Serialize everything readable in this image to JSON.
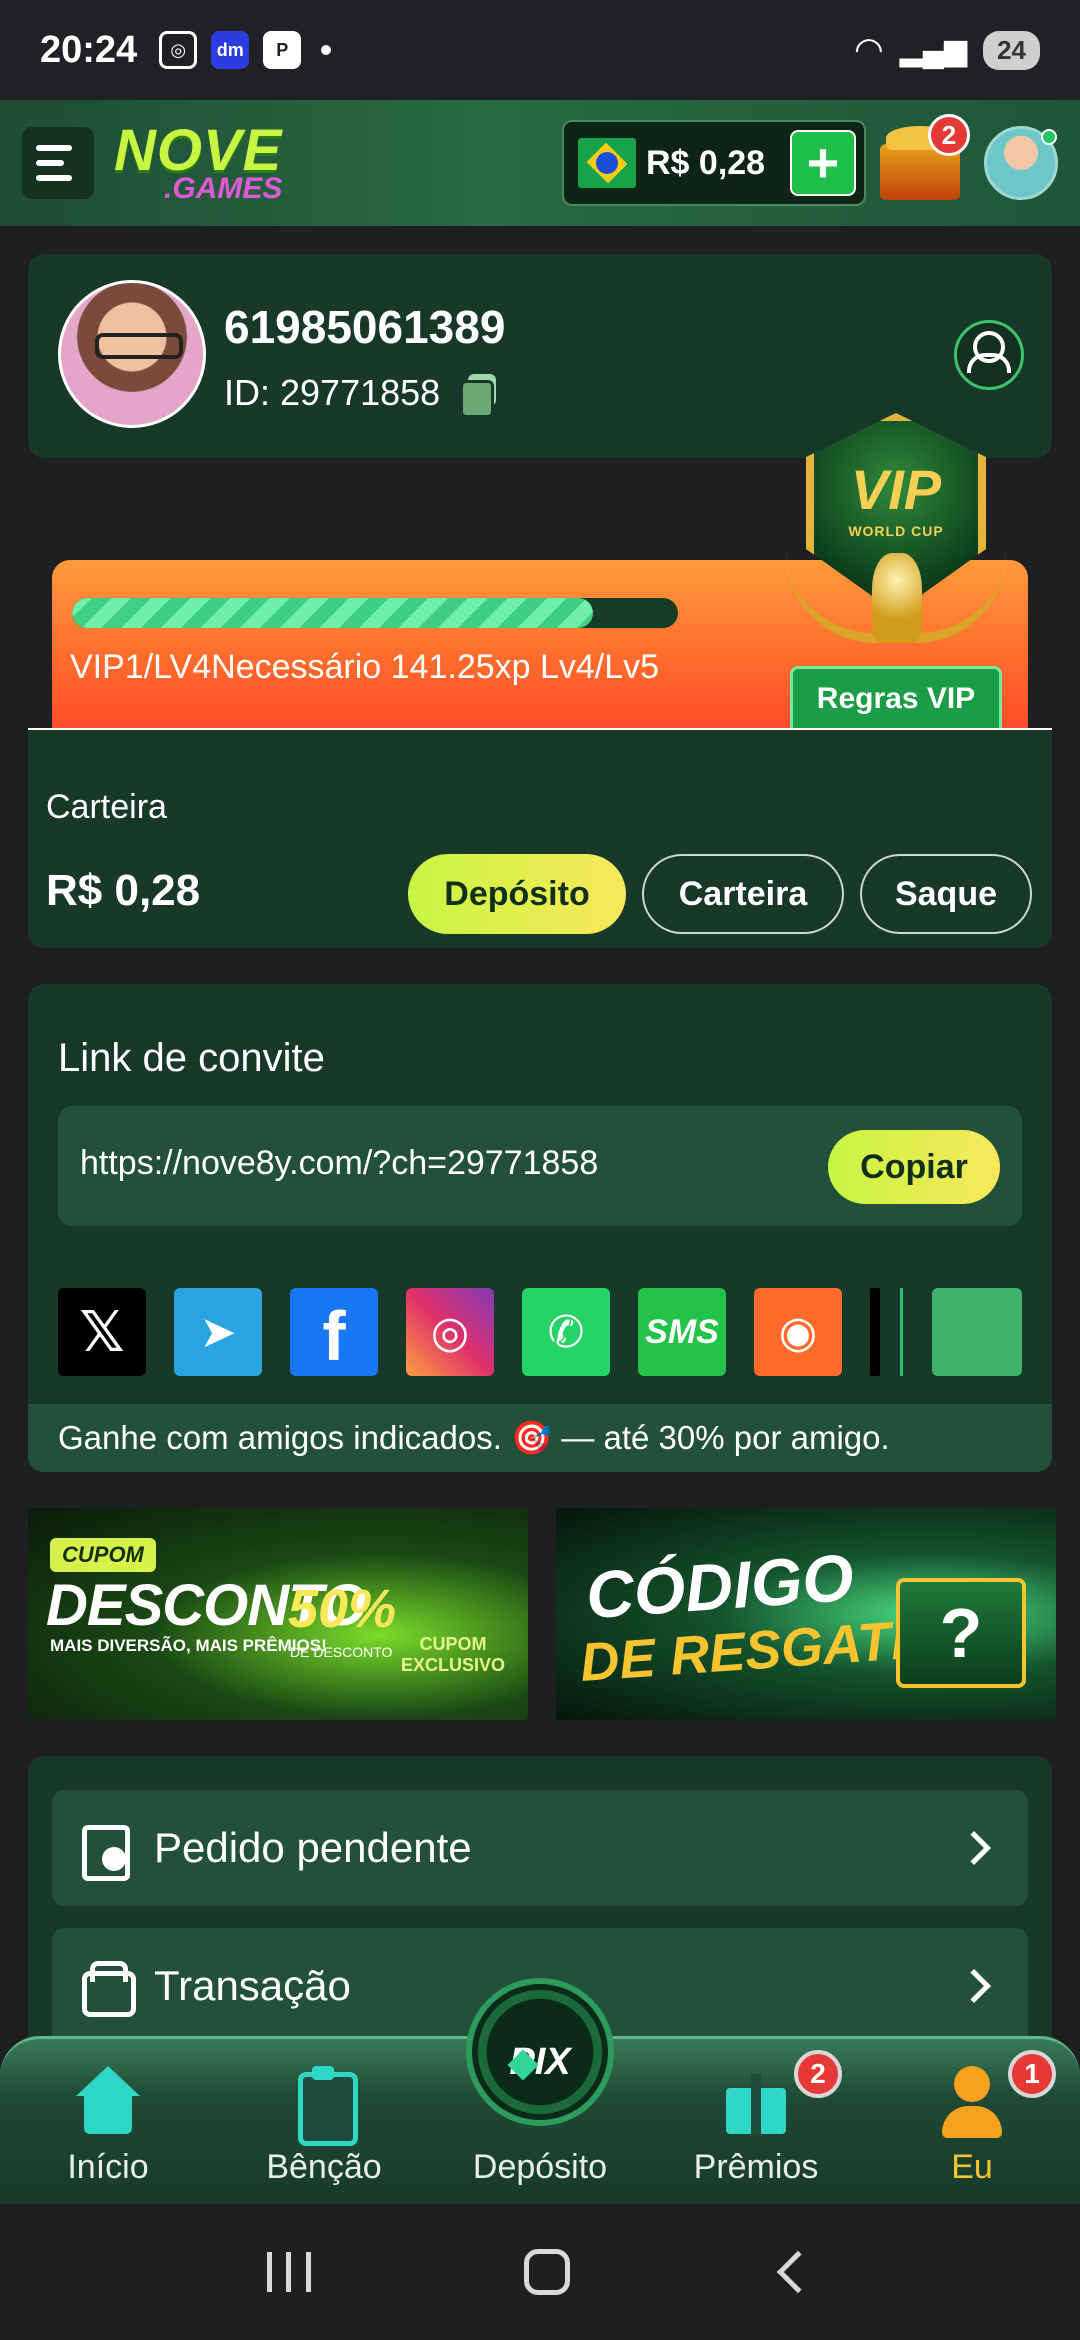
{
  "status_bar": {
    "time": "20:24",
    "app_icons": [
      "instagram-icon",
      "dm-icon",
      "pix-icon"
    ],
    "battery": "24"
  },
  "header": {
    "logo_top": "NOVE",
    "logo_bottom": ".GAMES",
    "balance": "R$ 0,28",
    "plus": "+",
    "gift_badge": "2"
  },
  "profile": {
    "phone": "61985061389",
    "id": "ID: 29771858"
  },
  "vip": {
    "badge_title": "VIP",
    "badge_sub": "WORLD CUP",
    "progress": 0.86,
    "text": "VIP1/LV4Necessário 141.25xp Lv4/Lv5",
    "rules_button": "Regras VIP"
  },
  "wallet": {
    "label": "Carteira",
    "amount": "R$ 0,28",
    "buttons": {
      "deposit": "Depósito",
      "wallet": "Carteira",
      "withdraw": "Saque"
    }
  },
  "invite": {
    "title": "Link de convite",
    "url": "https://nove8y.com/?ch=29771858",
    "copy_button": "Copiar",
    "socials": [
      "x-icon",
      "telegram-icon",
      "facebook-icon",
      "instagram-icon",
      "whatsapp-icon",
      "sms-icon",
      "kwai-icon",
      "more-apps-icon"
    ],
    "footer": "Ganhe com amigos indicados. 🎯 — até 30% por amigo."
  },
  "banners": {
    "discount": {
      "tag": "CUPOM",
      "title": "DESCONTO",
      "subtitle": "MAIS DIVERSÃO, MAIS PRÊMIOS!",
      "percent": "50%",
      "percent_sub": "DE DESCONTO",
      "coupon": "CUPOM EXCLUSIVO"
    },
    "code": {
      "line1": "CÓDIGO",
      "line2": "DE RESGATE",
      "mark": "?"
    }
  },
  "menu": {
    "items": [
      {
        "label": "Pedido pendente"
      },
      {
        "label": "Transação"
      }
    ]
  },
  "bottom_nav": {
    "items": [
      {
        "label": "Início"
      },
      {
        "label": "Bênção"
      },
      {
        "label": "Depósito"
      },
      {
        "label": "Prêmios",
        "badge": "2"
      },
      {
        "label": "Eu",
        "badge": "1"
      }
    ],
    "center": "PIX",
    "active_color": "#f6c431"
  }
}
